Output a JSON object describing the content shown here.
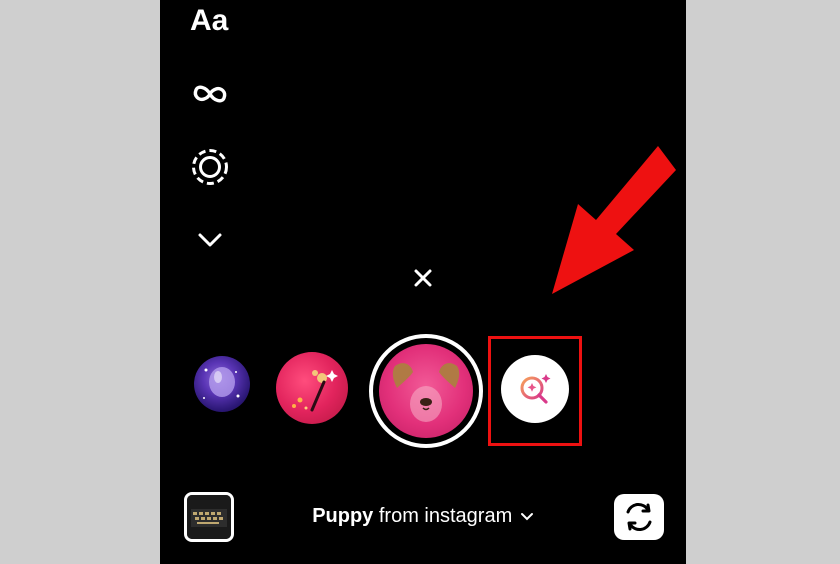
{
  "tools": {
    "text_label": "Aa",
    "boomerang_icon": "infinity-icon",
    "layout_icon": "dashed-circle-icon",
    "more_icon": "chevron-down-icon"
  },
  "close_icon": "close-icon",
  "effects": [
    {
      "name": "galaxy-effect",
      "icon": "purple-balloon"
    },
    {
      "name": "sparkle-effect",
      "icon": "magic-wand"
    },
    {
      "name": "puppy-effect",
      "icon": "puppy-face",
      "selected": true
    },
    {
      "name": "browse-effects",
      "icon": "sparkle-search-icon"
    }
  ],
  "footer": {
    "effect_name": "Puppy",
    "effect_source": "from instagram",
    "dropdown_icon": "chevron-down-icon",
    "flip_icon": "camera-flip-icon"
  },
  "annotation": {
    "arrow_color": "#ee1111",
    "box_color": "#ee1111"
  }
}
